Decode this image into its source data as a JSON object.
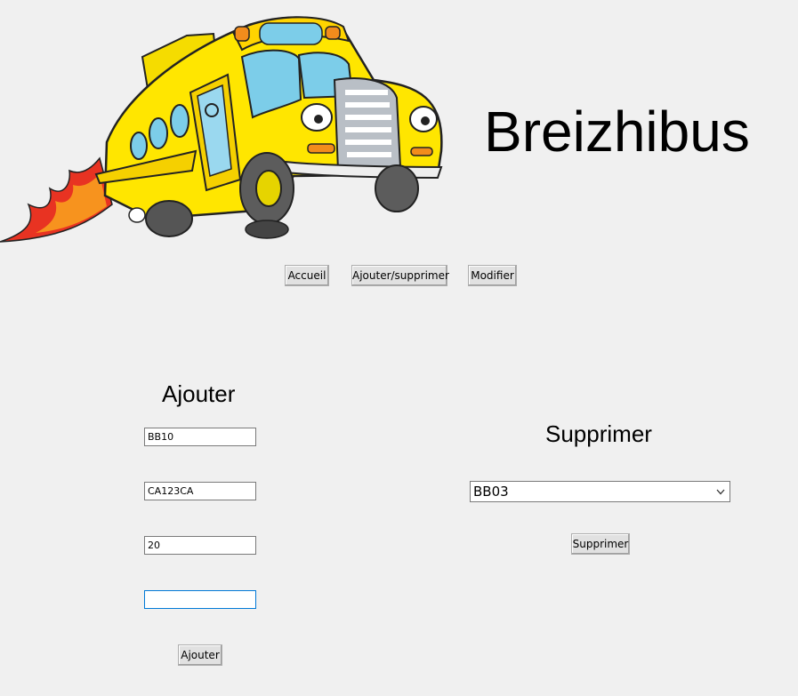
{
  "header": {
    "title": "Breizhibus"
  },
  "nav": {
    "home": "Accueil",
    "add_remove": "Ajouter/supprimer",
    "modify": "Modifier"
  },
  "add_section": {
    "title": "Ajouter",
    "fields": [
      "BB10",
      "CA123CA",
      "20",
      ""
    ],
    "submit": "Ajouter"
  },
  "remove_section": {
    "title": "Supprimer",
    "selected": "BB03",
    "submit": "Supprimer"
  },
  "colors": {
    "background": "#f0f0f0",
    "bus_yellow": "#ffe600",
    "focus_blue": "#0078d7"
  }
}
